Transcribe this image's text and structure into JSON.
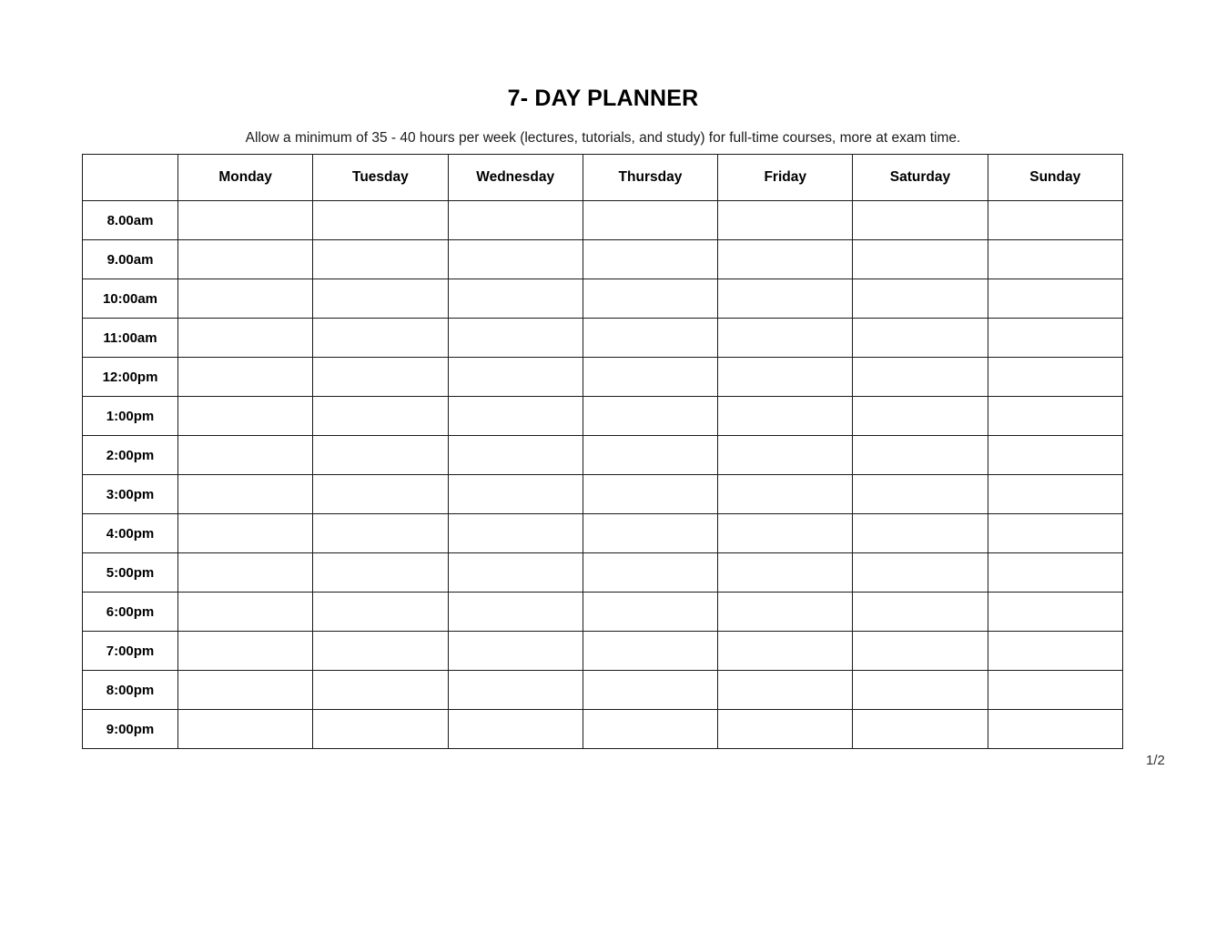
{
  "document": {
    "title": "7- DAY PLANNER",
    "subtitle": "Allow a minimum of 35 - 40 hours per week (lectures, tutorials, and study) for full-time courses, more at exam time.",
    "page_indicator": "1/2"
  },
  "planner": {
    "corner_header": "",
    "day_headers": [
      "Monday",
      "Tuesday",
      "Wednesday",
      "Thursday",
      "Friday",
      "Saturday",
      "Sunday"
    ],
    "time_rows": [
      "8.00am",
      "9.00am",
      "10:00am",
      "11:00am",
      "12:00pm",
      "1:00pm",
      "2:00pm",
      "3:00pm",
      "4:00pm",
      "5:00pm",
      "6:00pm",
      "7:00pm",
      "8:00pm",
      "9:00pm"
    ],
    "cells": [
      [
        "",
        "",
        "",
        "",
        "",
        "",
        ""
      ],
      [
        "",
        "",
        "",
        "",
        "",
        "",
        ""
      ],
      [
        "",
        "",
        "",
        "",
        "",
        "",
        ""
      ],
      [
        "",
        "",
        "",
        "",
        "",
        "",
        ""
      ],
      [
        "",
        "",
        "",
        "",
        "",
        "",
        ""
      ],
      [
        "",
        "",
        "",
        "",
        "",
        "",
        ""
      ],
      [
        "",
        "",
        "",
        "",
        "",
        "",
        ""
      ],
      [
        "",
        "",
        "",
        "",
        "",
        "",
        ""
      ],
      [
        "",
        "",
        "",
        "",
        "",
        "",
        ""
      ],
      [
        "",
        "",
        "",
        "",
        "",
        "",
        ""
      ],
      [
        "",
        "",
        "",
        "",
        "",
        "",
        ""
      ],
      [
        "",
        "",
        "",
        "",
        "",
        "",
        ""
      ],
      [
        "",
        "",
        "",
        "",
        "",
        "",
        ""
      ],
      [
        "",
        "",
        "",
        "",
        "",
        "",
        ""
      ]
    ]
  },
  "colors": {
    "page_background": "#ffffff",
    "text": "#000000",
    "grid_line": "#1a1a1a",
    "page_indicator": "#333333"
  }
}
